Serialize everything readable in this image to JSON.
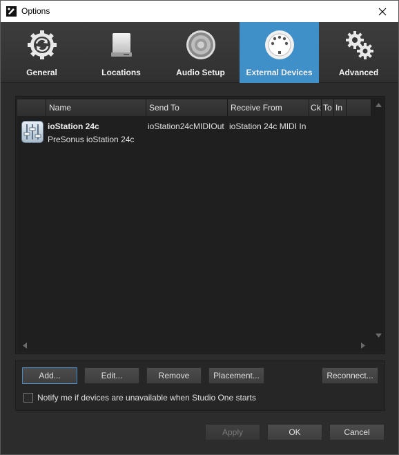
{
  "window": {
    "title": "Options",
    "close_icon": "close-icon"
  },
  "tabs": [
    {
      "label": "General",
      "icon": "refresh-gear-icon",
      "active": false
    },
    {
      "label": "Locations",
      "icon": "drive-icon",
      "active": false
    },
    {
      "label": "Audio Setup",
      "icon": "speaker-icon",
      "active": false
    },
    {
      "label": "External Devices",
      "icon": "midi-port-icon",
      "active": true
    },
    {
      "label": "Advanced",
      "icon": "gears-icon",
      "active": false
    }
  ],
  "table": {
    "columns": [
      "",
      "Name",
      "Send To",
      "Receive From",
      "Ck",
      "To",
      "In"
    ],
    "rows": [
      {
        "icon": "mixer-device-icon",
        "name": "ioStation 24c",
        "model": "PreSonus ioStation 24c",
        "send_to": "ioStation24cMIDIOut",
        "receive_from": "ioStation 24c MIDI In"
      }
    ]
  },
  "device_buttons": {
    "add": "Add...",
    "edit": "Edit...",
    "remove": "Remove",
    "placement": "Placement...",
    "reconnect": "Reconnect..."
  },
  "notify": {
    "label": "Notify me if devices are unavailable when Studio One starts",
    "checked": false
  },
  "dialog_buttons": {
    "apply": "Apply",
    "ok": "OK",
    "cancel": "Cancel"
  },
  "colors": {
    "active_tab": "#3f8fc9",
    "background": "#2c2c2c",
    "focus_border": "#4a8ac4"
  }
}
